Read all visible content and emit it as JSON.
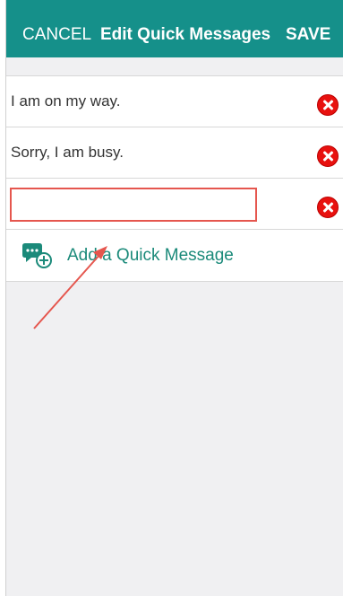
{
  "navbar": {
    "cancel_label": "CANCEL",
    "title": "Edit Quick Messages",
    "save_label": "SAVE"
  },
  "messages": [
    {
      "text": "I am on my way."
    },
    {
      "text": "Sorry, I am busy."
    },
    {
      "text": ""
    }
  ],
  "add": {
    "label": "Add a Quick Message",
    "icon": "chat-bubble-plus-icon"
  },
  "colors": {
    "navbar": "#15908a",
    "accent_text": "#1b8a7a",
    "delete": "#e8110f",
    "annotation": "#e5564e"
  }
}
